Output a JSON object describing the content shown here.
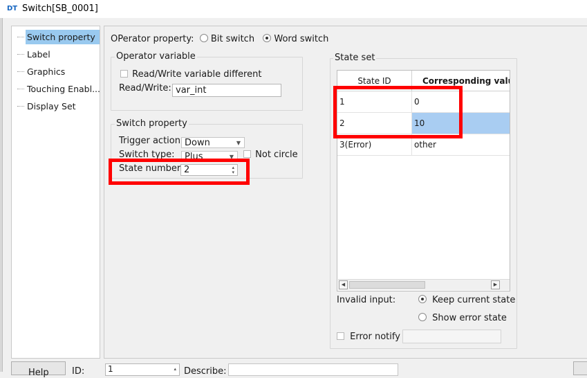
{
  "window": {
    "logo_text": "DT",
    "title": "Switch[SB_0001]"
  },
  "nav": {
    "items": [
      {
        "label": "Switch property",
        "selected": true
      },
      {
        "label": "Label",
        "selected": false
      },
      {
        "label": "Graphics",
        "selected": false
      },
      {
        "label": "Touching Enabl...",
        "selected": false
      },
      {
        "label": "Display Set",
        "selected": false
      }
    ]
  },
  "operator_property": {
    "label": "OPerator property:",
    "options": [
      "Bit switch",
      "Word switch"
    ],
    "selected": "Word switch"
  },
  "operator_variable": {
    "legend": "Operator variable",
    "rw_different_label": "Read/Write variable different",
    "rw_different_checked": false,
    "rw_label": "Read/Write:",
    "rw_value": "var_int"
  },
  "switch_property": {
    "legend": "Switch property",
    "trigger_label": "Trigger action",
    "trigger_value": "Down",
    "type_label": "Switch type:",
    "type_value": "Plus",
    "not_circle_label": "Not circle",
    "not_circle_checked": false,
    "state_number_label": "State number",
    "state_number_value": "2"
  },
  "state_set": {
    "legend": "State set",
    "columns": [
      "State ID",
      "Corresponding value"
    ],
    "rows": [
      {
        "id": "1",
        "value": "0"
      },
      {
        "id": "2",
        "value": "10"
      },
      {
        "id": "3(Error)",
        "value": "other"
      }
    ],
    "invalid_input_label": "Invalid input:",
    "invalid_options": [
      "Keep current state",
      "Show error state"
    ],
    "invalid_selected": "Keep current state",
    "error_notify_label": "Error notify",
    "error_notify_checked": false
  },
  "bottom": {
    "help_label": "Help",
    "id_label": "ID:",
    "id_value": "1",
    "describe_label": "Describe:"
  },
  "colors": {
    "selection": "#99c9ef",
    "highlight_box": "#ff0000",
    "cell_selected": "#a9cdf2"
  }
}
